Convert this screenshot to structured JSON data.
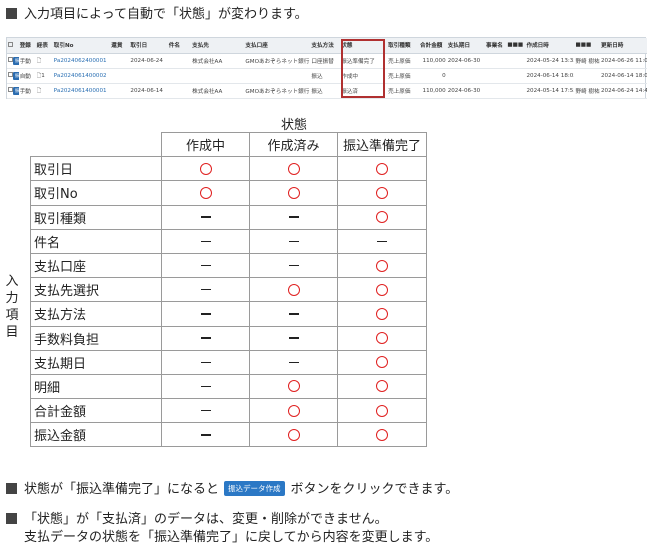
{
  "intro": "入力項目によって自動で「状態」が変わります。",
  "grid": {
    "headers": [
      "",
      "登録",
      "経表",
      "取引No",
      "還貨",
      "取引日",
      "件名",
      "支払先",
      "支払口座",
      "支払方法",
      "状態",
      "取引種類",
      "合計金額",
      "支払期日",
      "事業名",
      "■■■",
      "作成日時",
      "■■■",
      "更新日時"
    ],
    "rows": [
      [
        "",
        "手動",
        "",
        "Pa2024062400001",
        "",
        "2024-06-24",
        "",
        "株式会社AA",
        "GMOあおぞらネット銀行",
        "口座振替",
        "振込準備完了",
        "売上原価",
        "110,000",
        "2024-06-30",
        "",
        "",
        "2024-05-24 13:35",
        "野崎 樹祐",
        "2024-06-26 11:02"
      ],
      [
        "",
        "自動",
        "1",
        "Pa2024061400002",
        "",
        "",
        "",
        "",
        "",
        "振込",
        "作成中",
        "売上原価",
        "0",
        "",
        "",
        "",
        "2024-06-14 18:05",
        "",
        "2024-06-14 18:05"
      ],
      [
        "",
        "手動",
        "",
        "Pa2024061400001",
        "",
        "2024-06-14",
        "",
        "株式会社AA",
        "GMOあおぞらネット銀行",
        "振込",
        "振込済",
        "売上原価",
        "110,000",
        "2024-06-30",
        "",
        "",
        "2024-05-14 17:55",
        "野崎 樹祐",
        "2024-06-24 14:49"
      ]
    ],
    "row_button": "振込"
  },
  "table": {
    "super_header": "状態",
    "side_label": [
      "入",
      "力",
      "項",
      "目"
    ],
    "columns": [
      "作成中",
      "作成済み",
      "振込準備完了"
    ],
    "rows": [
      {
        "label": "取引日",
        "cells": [
          "o",
          "o",
          "o"
        ]
      },
      {
        "label": "取引No",
        "cells": [
          "o",
          "o",
          "o"
        ]
      },
      {
        "label": "取引種類",
        "cells": [
          "-",
          "-",
          "o"
        ]
      },
      {
        "label": "件名",
        "cells": [
          "-",
          "-",
          "-"
        ]
      },
      {
        "label": "支払口座",
        "cells": [
          "-",
          "-",
          "o"
        ]
      },
      {
        "label": "支払先選択",
        "cells": [
          "-",
          "o",
          "o"
        ]
      },
      {
        "label": "支払方法",
        "cells": [
          "-",
          "-",
          "o"
        ]
      },
      {
        "label": "手数料負担",
        "cells": [
          "-",
          "-",
          "o"
        ]
      },
      {
        "label": "支払期日",
        "cells": [
          "-",
          "-",
          "o"
        ]
      },
      {
        "label": "明細",
        "cells": [
          "-",
          "o",
          "o"
        ]
      },
      {
        "label": "合計金額",
        "cells": [
          "-",
          "o",
          "o"
        ]
      },
      {
        "label": "振込金額",
        "cells": [
          "-",
          "o",
          "o"
        ]
      }
    ]
  },
  "note1": {
    "before": "状態が「振込準備完了」になると",
    "button": "振込データ作成",
    "after": "ボタンをクリックできます。"
  },
  "note2": {
    "line1": "「状態」が「支払済」のデータは、変更・削除ができません。",
    "line2": "支払データの状態を「振込準備完了」に戻してから内容を変更します。"
  },
  "colors": {
    "circle": "#e02020",
    "highlight": "#b03030",
    "button": "#2b78c5"
  }
}
